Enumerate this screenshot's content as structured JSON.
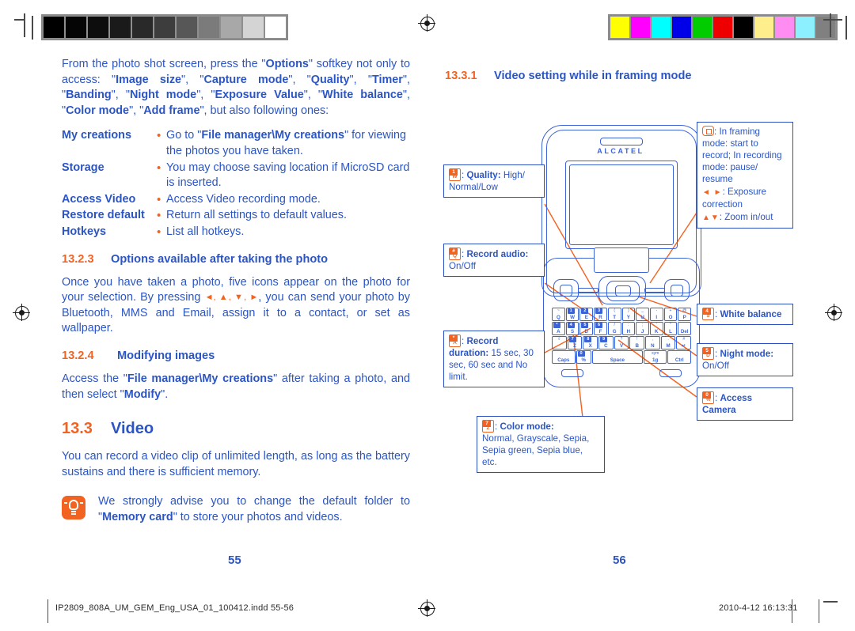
{
  "document": {
    "left_page_number": "55",
    "right_page_number": "56",
    "footer_filename": "IP2809_808A_UM_GEM_Eng_USA_01_100412.indd  55-56",
    "footer_timestamp": "2010-4-12   16:13:31"
  },
  "calibration": {
    "grayscale_label": "grayscale-calibration-strip",
    "grayscale_swatches": [
      "#000000",
      "#050505",
      "#0d0d0d",
      "#1a1a1a",
      "#292929",
      "#3d3d3d",
      "#575757",
      "#7b7b7b",
      "#a8a8a8",
      "#d4d4d4",
      "#ffffff"
    ],
    "color_label": "color-calibration-strip",
    "color_swatches": [
      "#ffff00",
      "#ff00ff",
      "#00ffff",
      "#0000e8",
      "#00cc00",
      "#ee0000",
      "#000000",
      "#ffef8c",
      "#ff8cf0",
      "#8cf0ff",
      "#808080"
    ]
  },
  "left_column": {
    "intro": {
      "part1": "From the photo shot screen, press the \"",
      "options": "Options",
      "part2": "\" softkey not only to access: \"",
      "terms": [
        "Image size",
        "Capture mode",
        "Quality",
        "Timer",
        "Banding",
        "Night mode",
        "Exposure Value",
        "White balance",
        "Color mode",
        "Add frame"
      ],
      "part3": "\", but also following ones:"
    },
    "definitions": [
      {
        "term": "My creations",
        "desc_pre": "Go to \"",
        "desc_bold": "File manager\\My creations",
        "desc_post": "\" for viewing the photos you have taken."
      },
      {
        "term": "Storage",
        "desc_pre": "You may choose saving location if MicroSD card is inserted.",
        "desc_bold": "",
        "desc_post": ""
      },
      {
        "term": "Access Video",
        "desc_pre": "Access Video recording mode.",
        "desc_bold": "",
        "desc_post": ""
      },
      {
        "term": "Restore default",
        "desc_pre": "Return all settings to default values.",
        "desc_bold": "",
        "desc_post": ""
      },
      {
        "term": "Hotkeys",
        "desc_pre": "List all hotkeys.",
        "desc_bold": "",
        "desc_post": ""
      }
    ],
    "heading_1323": {
      "number": "13.2.3",
      "title": "Options available after taking the photo"
    },
    "para_1323_a": "Once you have taken a photo, five icons appear on the photo for your selection. By pressing ",
    "para_1323_arrows": "◄, ▲, ▼, ►",
    "para_1323_b": ", you can send your photo by Bluetooth, MMS and Email, assign it to a contact, or set as wallpaper.",
    "heading_1324": {
      "number": "13.2.4",
      "title": "Modifying images"
    },
    "para_1324_pre": "Access the \"",
    "para_1324_bold1": "File manager\\My creations",
    "para_1324_mid": "\" after taking a photo, and then select \"",
    "para_1324_bold2": "Modify",
    "para_1324_post": "\".",
    "heading_133": {
      "number": "13.3",
      "title": "Video"
    },
    "para_133": "You can record a video clip of unlimited length, as long as the battery sustains and there is sufficient memory.",
    "tip": {
      "icon": "lightbulb-icon",
      "pre": "We strongly advise you to change the default folder to \"",
      "bold": "Memory card",
      "post": "\" to store your photos and videos."
    }
  },
  "right_column": {
    "heading_1331": {
      "number": "13.3.1",
      "title": "Video setting while in framing mode"
    }
  },
  "figure": {
    "phone": {
      "brand": "ALCATEL",
      "keypad_rows": [
        [
          {
            "sym": "~",
            "alpha": "Q",
            "highlight": false
          },
          {
            "sym": "1",
            "alpha": "W",
            "highlight": true
          },
          {
            "sym": "2",
            "alpha": "E",
            "highlight": true
          },
          {
            "sym": "3",
            "alpha": "R",
            "highlight": true
          },
          {
            "sym": "(",
            "alpha": "T",
            "highlight": false
          },
          {
            "sym": ")",
            "alpha": "Y",
            "highlight": false
          },
          {
            "sym": "_",
            "alpha": "U",
            "highlight": false
          },
          {
            "sym": "-",
            "alpha": "I",
            "highlight": false
          },
          {
            "sym": "+",
            "alpha": "O",
            "highlight": false
          },
          {
            "sym": "@",
            "alpha": "P",
            "highlight": false
          }
        ],
        [
          {
            "sym": "*",
            "alpha": "A",
            "highlight": true
          },
          {
            "sym": "4",
            "alpha": "S",
            "highlight": true
          },
          {
            "sym": "5",
            "alpha": "D",
            "highlight": true
          },
          {
            "sym": "6",
            "alpha": "F",
            "highlight": true
          },
          {
            "sym": "/",
            "alpha": "G",
            "highlight": false
          },
          {
            "sym": ":",
            "alpha": "H",
            "highlight": false
          },
          {
            "sym": ";",
            "alpha": "J",
            "highlight": false
          },
          {
            "sym": "'",
            "alpha": "K",
            "highlight": false
          },
          {
            "sym": "\"",
            "alpha": "L",
            "highlight": false
          },
          {
            "sym": "",
            "alpha": "Del",
            "highlight": false
          }
        ],
        [
          {
            "sym": "⇧",
            "alpha": "",
            "highlight": false
          },
          {
            "sym": "7",
            "alpha": "Z",
            "highlight": true
          },
          {
            "sym": "8",
            "alpha": "X",
            "highlight": true
          },
          {
            "sym": "9",
            "alpha": "C",
            "highlight": true
          },
          {
            "sym": "?",
            "alpha": "V",
            "highlight": false
          },
          {
            "sym": "!",
            "alpha": "B",
            "highlight": false
          },
          {
            "sym": ",",
            "alpha": "N",
            "highlight": false
          },
          {
            "sym": ".",
            "alpha": "M",
            "highlight": false
          },
          {
            "sym": "#",
            "alpha": "↵",
            "highlight": false
          }
        ],
        [
          {
            "sym": "",
            "alpha": "Caps",
            "highlight": false
          },
          {
            "sym": "0",
            "alpha": "%",
            "highlight": true
          },
          {
            "sym": "",
            "alpha": "Space",
            "highlight": false
          },
          {
            "sym": "sym",
            "alpha": "1g",
            "highlight": false
          },
          {
            "sym": "",
            "alpha": "Ctrl",
            "highlight": false
          }
        ]
      ]
    },
    "callouts": [
      {
        "id": "quality",
        "icon": {
          "type": "key",
          "top": "1",
          "bottom": "W"
        },
        "title": "Quality:",
        "value": " High/ Normal/Low"
      },
      {
        "id": "record-audio",
        "icon": {
          "type": "key",
          "top": "#",
          "bottom": "Q"
        },
        "title": "Record audio:",
        "value": " On/Off"
      },
      {
        "id": "record-duration",
        "icon": {
          "type": "key",
          "top": "*",
          "bottom": "A"
        },
        "title": "Record duration:",
        "value": " 15 sec, 30 sec, 60 sec and No limit."
      },
      {
        "id": "color-mode",
        "icon": {
          "type": "key",
          "top": "7",
          "bottom": "Z"
        },
        "title": "Color mode:",
        "value": "Normal, Grayscale, Sepia, Sepia green, Sepia blue, etc."
      },
      {
        "id": "white-balance",
        "icon": {
          "type": "key",
          "top": "4",
          "bottom": "S"
        },
        "title": "White balance",
        "value": ""
      },
      {
        "id": "night-mode",
        "icon": {
          "type": "key",
          "top": "5",
          "bottom": "D"
        },
        "title": "Night mode:",
        "value": " On/Off"
      },
      {
        "id": "access-camera",
        "icon": {
          "type": "key",
          "top": "0",
          "bottom": "%"
        },
        "title": "Access Camera",
        "value": ""
      }
    ],
    "navigation_callout": {
      "ok_icon": "ok-key-icon",
      "ok_text": ": In framing mode: start to record; In recording mode: pause/ resume",
      "lr_icon": "◄ ►",
      "lr_text": ": Exposure correction",
      "ud_icon": "▲▼",
      "ud_text": ": Zoom in/out"
    }
  }
}
